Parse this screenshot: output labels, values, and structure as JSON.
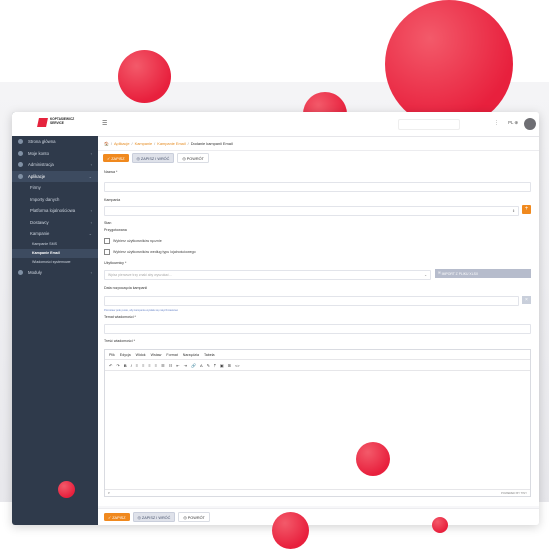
{
  "brand": {
    "logo_line1": "KOPTASIEWICZ",
    "logo_line2": "SERVICE",
    "accent_color": "#f0891e",
    "circle_color": "#e8203d"
  },
  "sidebar": {
    "items": [
      {
        "label": "Strona główna",
        "icon": "home-icon",
        "chevron": ""
      },
      {
        "label": "Moje konto",
        "icon": "user-icon",
        "chevron": "‹"
      },
      {
        "label": "Administracja",
        "icon": "gear-icon",
        "chevron": "‹"
      },
      {
        "label": "Aplikacje",
        "icon": "apps-icon",
        "chevron": "⌄"
      }
    ],
    "sub_items": [
      {
        "label": "Firmy",
        "chevron": ""
      },
      {
        "label": "Importy danych",
        "chevron": ""
      },
      {
        "label": "Platforma lojalnościowa",
        "chevron": "‹"
      },
      {
        "label": "Dostawcy",
        "chevron": "‹"
      },
      {
        "label": "Kampanie",
        "chevron": "⌄"
      }
    ],
    "campaign_items": [
      {
        "label": "Kampanie SMS"
      },
      {
        "label": "Kampanie Email"
      },
      {
        "label": "Wiadomości systemowe"
      }
    ],
    "modules": {
      "label": "Moduły",
      "chevron": "‹"
    }
  },
  "topbar": {
    "menu_icon": "☰",
    "more": "⋮",
    "lang": "PL ⊕"
  },
  "breadcrumb": {
    "items": [
      "Aplikacje",
      "Kampanie",
      "Kampanie Email"
    ],
    "current": "Dodanie kampanii Email"
  },
  "actions": {
    "save": "✓ ZAPISZ",
    "save_close": "◎ ZAPISZ I WRÓĆ",
    "back": "◎ POWRÓT"
  },
  "form": {
    "name_label": "Nazwa *",
    "campaign_label": "Kampania",
    "state_label": "Stan",
    "state_value": "Przygotowana",
    "checkbox1": "Wybierz użytkowników ręcznie",
    "checkbox2": "Wybierz użytkowników według typu lojalnościowego",
    "recipients_label": "Użytkownicy *",
    "recipients_placeholder": "Wpisz pierwsze trzy znaki aby wyszukać...",
    "import_button": "IMPORT Z PLIKU XLSX",
    "start_label": "Data rozpoczęcia kampanii",
    "start_hint": "Pozostaw pole puste, aby kampania wysłała się natychmiastowo",
    "subject_label": "Temat wiadomości *",
    "body_label": "Treść wiadomości *",
    "editor_menu": [
      "Plik",
      "Edycja",
      "Widok",
      "Wstaw",
      "Format",
      "Narzędzia",
      "Tabela"
    ],
    "editor_status_left": "P",
    "editor_status_right": "POWERED BY TINY"
  }
}
